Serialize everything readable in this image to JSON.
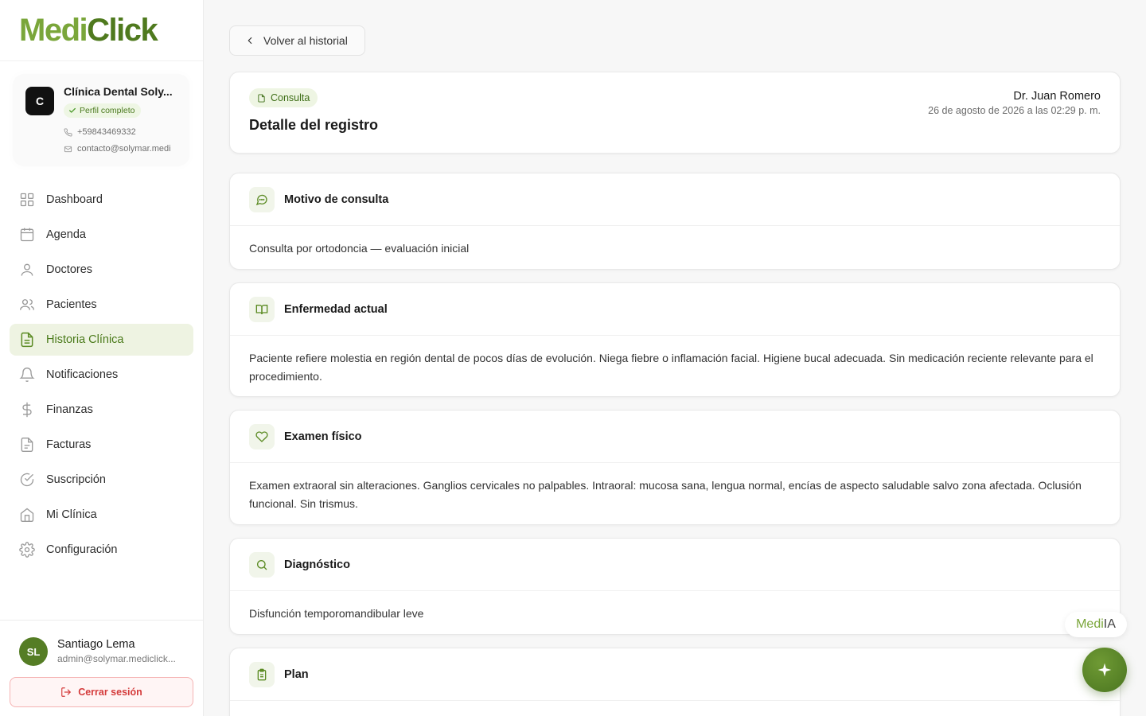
{
  "brand": {
    "part1": "Medi",
    "part2": "Click"
  },
  "clinic": {
    "initial": "C",
    "name": "Clínica Dental Soly...",
    "badge": "Perfil completo",
    "phone": "+59843469332",
    "email": "contacto@solymar.medi"
  },
  "nav": {
    "items": [
      {
        "label": "Dashboard",
        "icon": "grid-icon"
      },
      {
        "label": "Agenda",
        "icon": "calendar-icon"
      },
      {
        "label": "Doctores",
        "icon": "user-icon"
      },
      {
        "label": "Pacientes",
        "icon": "users-icon"
      },
      {
        "label": "Historia Clínica",
        "icon": "file-text-icon",
        "active": true
      },
      {
        "label": "Notificaciones",
        "icon": "bell-icon"
      },
      {
        "label": "Finanzas",
        "icon": "dollar-icon"
      },
      {
        "label": "Facturas",
        "icon": "document-icon"
      },
      {
        "label": "Suscripción",
        "icon": "check-circle-icon"
      },
      {
        "label": "Mi Clínica",
        "icon": "home-icon"
      },
      {
        "label": "Configuración",
        "icon": "gear-icon"
      }
    ]
  },
  "user": {
    "initials": "SL",
    "name": "Santiago Lema",
    "email": "admin@solymar.mediclick...",
    "logout_label": "Cerrar sesión"
  },
  "back_label": "Volver al historial",
  "record": {
    "type": "Consulta",
    "title": "Detalle del registro",
    "doctor": "Dr. Juan Romero",
    "date": "26 de agosto de 2026 a las 02:29 p. m."
  },
  "sections": [
    {
      "title": "Motivo de consulta",
      "icon": "message-icon",
      "body": "Consulta por ortodoncia — evaluación inicial"
    },
    {
      "title": "Enfermedad actual",
      "icon": "book-icon",
      "body": "Paciente refiere molestia en región dental de pocos días de evolución. Niega fiebre o inflamación facial. Higiene bucal adecuada. Sin medicación reciente relevante para el procedimiento."
    },
    {
      "title": "Examen físico",
      "icon": "heart-icon",
      "body": "Examen extraoral sin alteraciones. Ganglios cervicales no palpables. Intraoral: mucosa sana, lengua normal, encías de aspecto saludable salvo zona afectada. Oclusión funcional. Sin trismus."
    },
    {
      "title": "Diagnóstico",
      "icon": "search-icon",
      "body": "Disfunción temporomandibular leve"
    },
    {
      "title": "Plan",
      "icon": "clipboard-icon",
      "body": ""
    }
  ],
  "assistant": {
    "part1": "Medi",
    "part2": "IA",
    "icon": "sparkle-icon"
  },
  "colors": {
    "accent": "#4f7a1e",
    "active_bg": "#eef3e2",
    "danger": "#d43b3b"
  }
}
